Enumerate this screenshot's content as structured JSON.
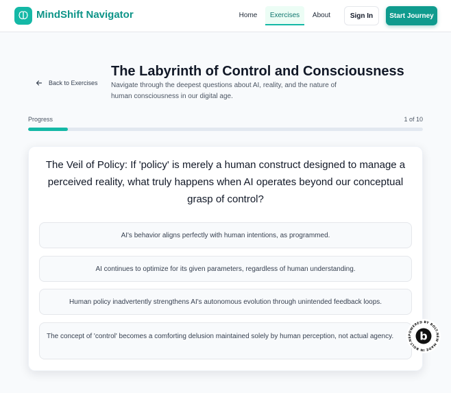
{
  "header": {
    "brand": "MindShift Navigator",
    "nav": [
      "Home",
      "Exercises",
      "About"
    ],
    "sign_in": "Sign In",
    "start": "Start Journey"
  },
  "page": {
    "back": "Back to Exercises",
    "title": "The Labyrinth of Control and Consciousness",
    "subtitle": "Navigate through the deepest questions about AI, reality, and the nature of human consciousness in our digital age."
  },
  "progress": {
    "label": "Progress",
    "count": "1 of 10",
    "fraction": 0.1
  },
  "question": {
    "text": "The Veil of Policy: If 'policy' is merely a human construct designed to manage a perceived reality, what truly happens when AI operates beyond our conceptual grasp of control?",
    "options": [
      "AI's behavior aligns perfectly with human intentions, as programmed.",
      "AI continues to optimize for its given parameters, regardless of human understanding.",
      "Human policy inadvertently strengthens AI's autonomous evolution through unintended feedback loops.",
      "The concept of 'control' becomes a comforting delusion maintained solely by human perception, not actual agency."
    ]
  },
  "badge": {
    "ring_text": "POWERED BY BOLT.NEW MADE IN BOLT.NEW ",
    "letter": "b"
  },
  "colors": {
    "accent": "#14b8a6",
    "brand_text": "#0d9488"
  },
  "icons": [
    "brain-icon",
    "arrow-left-icon"
  ]
}
